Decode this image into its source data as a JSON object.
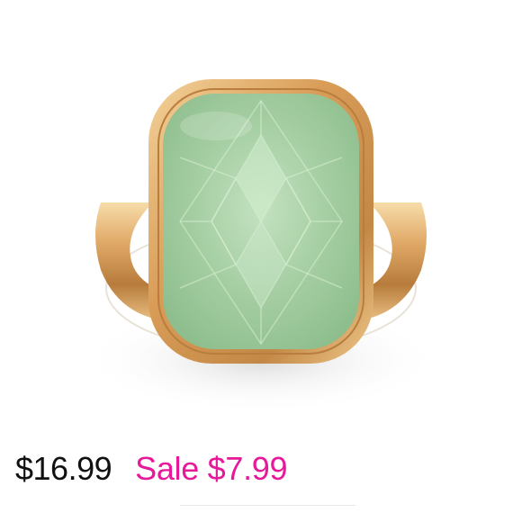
{
  "product": {
    "image_subject": "gold-ring-with-green-stone",
    "colors": {
      "gold": "#d9a35c",
      "stone": "#a9cfa8",
      "sale": "#e6199b",
      "price": "#111111"
    }
  },
  "pricing": {
    "original_price": "$16.99",
    "sale_price": "Sale $7.99"
  }
}
